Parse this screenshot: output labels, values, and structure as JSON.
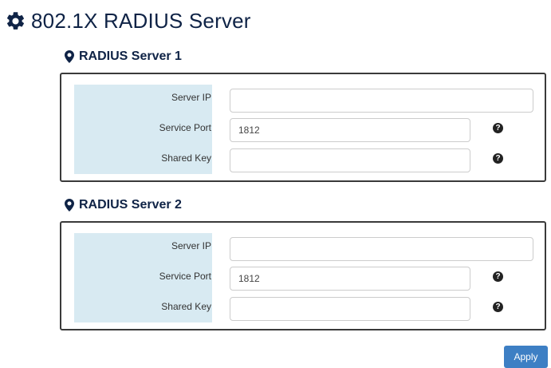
{
  "page": {
    "title": "802.1X RADIUS Server",
    "icon": "gear-icon"
  },
  "servers": [
    {
      "heading": "RADIUS Server 1",
      "icon": "map-marker-icon",
      "fields": {
        "server_ip": {
          "label": "Server IP",
          "value": ""
        },
        "service_port": {
          "label": "Service Port",
          "value": "1812"
        },
        "shared_key": {
          "label": "Shared Key",
          "value": ""
        }
      }
    },
    {
      "heading": "RADIUS Server 2",
      "icon": "map-marker-icon",
      "fields": {
        "server_ip": {
          "label": "Server IP",
          "value": ""
        },
        "service_port": {
          "label": "Service Port",
          "value": "1812"
        },
        "shared_key": {
          "label": "Shared Key",
          "value": ""
        }
      }
    }
  ],
  "help_icon_glyph": "?",
  "actions": {
    "apply_label": "Apply"
  },
  "colors": {
    "heading": "#0f2346",
    "label_background": "#d8eaf2",
    "apply_button": "#3d7fc4"
  }
}
